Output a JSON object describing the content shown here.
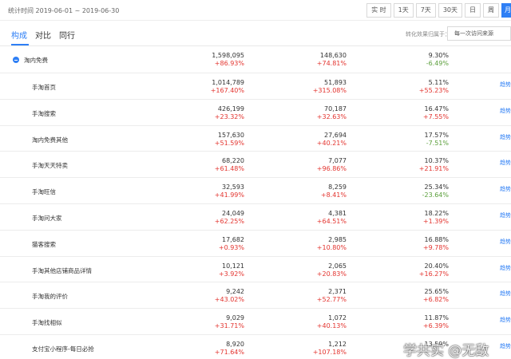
{
  "period": "统计时间 2019-06-01 ~ 2019-06-30",
  "range_buttons": [
    "实 时",
    "1天",
    "7天",
    "30天",
    "日",
    "周",
    "月"
  ],
  "tabs": [
    "构成",
    "对比",
    "同行"
  ],
  "attribution": {
    "label": "转化效果归属于：",
    "value": "每一次访问来源"
  },
  "rows": [
    {
      "name": "淘内免费",
      "v1": "1,598,095",
      "c1": "+86.93%",
      "v2": "148,630",
      "c2": "+74.81%",
      "v3": "9.30%",
      "c3": "-6.49%",
      "trend": ""
    },
    {
      "name": "手淘首页",
      "v1": "1,014,789",
      "c1": "+167.40%",
      "v2": "51,893",
      "c2": "+315.08%",
      "v3": "5.11%",
      "c3": "+55.23%",
      "trend": "趋势"
    },
    {
      "name": "手淘搜索",
      "v1": "426,199",
      "c1": "+23.32%",
      "v2": "70,187",
      "c2": "+32.63%",
      "v3": "16.47%",
      "c3": "+7.55%",
      "trend": "趋势"
    },
    {
      "name": "淘内免费其他",
      "v1": "157,630",
      "c1": "+51.59%",
      "v2": "27,694",
      "c2": "+40.21%",
      "v3": "17.57%",
      "c3": "-7.51%",
      "trend": "趋势"
    },
    {
      "name": "手淘天天特卖",
      "v1": "68,220",
      "c1": "+61.48%",
      "v2": "7,077",
      "c2": "+96.86%",
      "v3": "10.37%",
      "c3": "+21.91%",
      "trend": "趋势"
    },
    {
      "name": "手淘旺信",
      "v1": "32,593",
      "c1": "+41.99%",
      "v2": "8,259",
      "c2": "+8.41%",
      "v3": "25.34%",
      "c3": "-23.64%",
      "trend": "趋势"
    },
    {
      "name": "手淘问大家",
      "v1": "24,049",
      "c1": "+62.25%",
      "v2": "4,381",
      "c2": "+64.51%",
      "v3": "18.22%",
      "c3": "+1.39%",
      "trend": "趋势"
    },
    {
      "name": "猫客搜索",
      "v1": "17,682",
      "c1": "+0.93%",
      "v2": "2,985",
      "c2": "+10.80%",
      "v3": "16.88%",
      "c3": "+9.78%",
      "trend": "趋势"
    },
    {
      "name": "手淘其他店铺商品详情",
      "v1": "10,121",
      "c1": "+3.92%",
      "v2": "2,065",
      "c2": "+20.83%",
      "v3": "20.40%",
      "c3": "+16.27%",
      "trend": "趋势"
    },
    {
      "name": "手淘我的评价",
      "v1": "9,242",
      "c1": "+43.02%",
      "v2": "2,371",
      "c2": "+52.77%",
      "v3": "25.65%",
      "c3": "+6.82%",
      "trend": "趋势"
    },
    {
      "name": "手淘找相似",
      "v1": "9,029",
      "c1": "+31.71%",
      "v2": "1,072",
      "c2": "+40.13%",
      "v3": "11.87%",
      "c3": "+6.39%",
      "trend": "趋势"
    },
    {
      "name": "支付宝小程序-每日必抢",
      "v1": "8,920",
      "c1": "+71.64%",
      "v2": "1,212",
      "c2": "+107.18%",
      "v3": "13.59%",
      "c3": "",
      "trend": "趋势"
    }
  ],
  "watermark": "学共实 @无敌",
  "colors": {
    "accent": "#2e7ff5",
    "increase": "#e3342f",
    "decrease": "#5a9e3a"
  }
}
